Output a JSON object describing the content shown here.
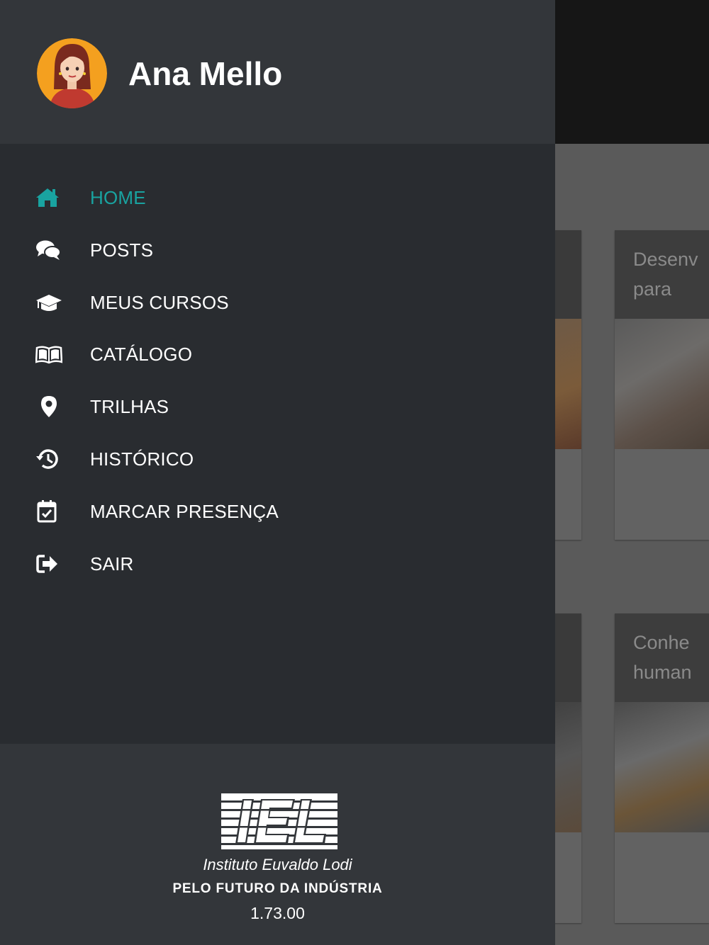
{
  "user": {
    "name": "Ana Mello"
  },
  "menu": [
    {
      "label": "HOME",
      "icon": "home-icon",
      "active": true
    },
    {
      "label": "POSTS",
      "icon": "chat-bubbles-icon",
      "active": false
    },
    {
      "label": "MEUS CURSOS",
      "icon": "graduation-cap-icon",
      "active": false
    },
    {
      "label": "CATÁLOGO",
      "icon": "open-book-icon",
      "active": false
    },
    {
      "label": "TRILHAS",
      "icon": "map-pin-icon",
      "active": false
    },
    {
      "label": "HISTÓRICO",
      "icon": "history-icon",
      "active": false
    },
    {
      "label": "MARCAR PRESENÇA",
      "icon": "calendar-check-icon",
      "active": false
    },
    {
      "label": "SAIR",
      "icon": "sign-out-icon",
      "active": false
    }
  ],
  "footer": {
    "logo_text": "IEL",
    "logo_subtitle": "Instituto Euvaldo Lodi",
    "tagline": "PELO FUTURO DA INDÚSTRIA",
    "version": "1.73.00"
  },
  "background_cards": [
    {
      "title": "Desenv\npara"
    },
    {
      "title": "Conhe\nhuman"
    }
  ],
  "colors": {
    "drawer_bg": "#292c30",
    "drawer_header_bg": "#33363a",
    "accent": "#19a3a0",
    "text": "#ffffff"
  }
}
